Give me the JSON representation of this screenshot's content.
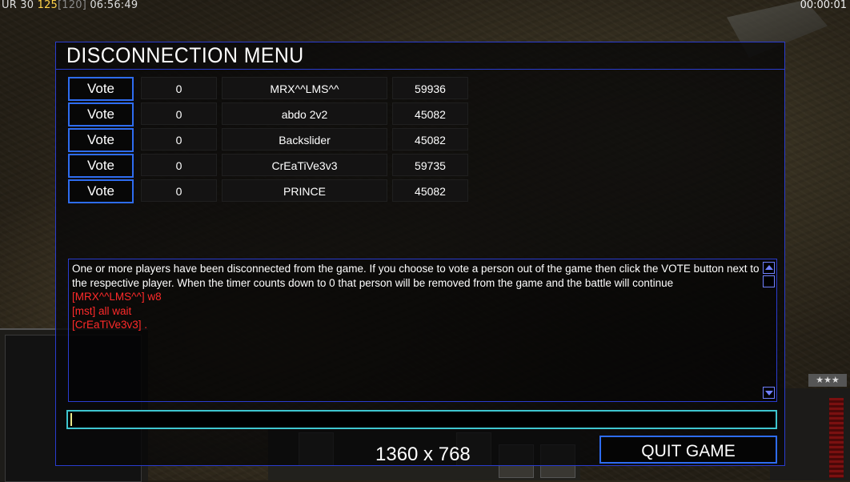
{
  "hud": {
    "status_prefix": "UR",
    "fps": "30",
    "value_a": "125",
    "value_b": "[120]",
    "clock": "06:56:49",
    "timer": "00:00:01"
  },
  "dialog": {
    "title": "DISCONNECTION MENU",
    "players": [
      {
        "vote_label": "Vote",
        "votes": "0",
        "name": "MRX^^LMS^^",
        "ping": "59936"
      },
      {
        "vote_label": "Vote",
        "votes": "0",
        "name": "abdo 2v2",
        "ping": "45082"
      },
      {
        "vote_label": "Vote",
        "votes": "0",
        "name": "Backslider",
        "ping": "45082"
      },
      {
        "vote_label": "Vote",
        "votes": "0",
        "name": "CrEaTiVe3v3",
        "ping": "59735"
      },
      {
        "vote_label": "Vote",
        "votes": "0",
        "name": "PRINCE",
        "ping": "45082"
      }
    ],
    "chat": {
      "system_message": "One or more players have been disconnected from the game. If you choose to vote a person out of the game then click the VOTE button next to the respective player. When the timer counts down to 0 that person will be removed from the game and the battle will continue",
      "messages": [
        "[MRX^^LMS^^] w8",
        "[mst] all wait",
        "[CrEaTiVe3v3] ."
      ],
      "message_color": "#ff2a2a"
    },
    "chat_input_value": "",
    "resolution_label": "1360 x 768",
    "quit_label": "QUIT GAME"
  },
  "accent_colors": {
    "dialog_border": "#2a3ccf",
    "button_border": "#2e6cf0",
    "input_border": "#3ec5cf"
  },
  "icons": [
    "scroll-up-arrow-icon",
    "scroll-down-arrow-icon",
    "rank-stars-icon"
  ]
}
